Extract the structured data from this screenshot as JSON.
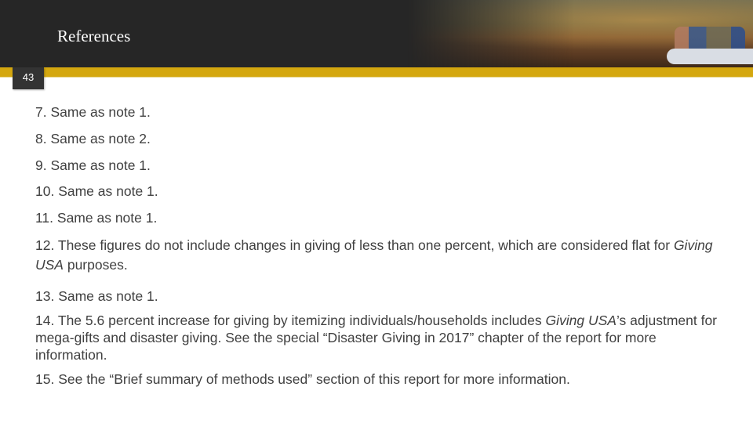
{
  "slide": {
    "title": "References",
    "page_number": "43"
  },
  "notes": [
    {
      "id": "7",
      "text": "7. Same as note 1."
    },
    {
      "id": "8",
      "text": "8. Same as note 2."
    },
    {
      "id": "9",
      "text": "9. Same as note 1."
    },
    {
      "id": "10",
      "text": "10. Same as note 1."
    },
    {
      "id": "11",
      "text": "11. Same as note 1."
    },
    {
      "id": "12",
      "parts": [
        "12. These figures do not include changes in giving of less than one percent, which are considered flat for ",
        "Giving USA",
        " purposes."
      ]
    },
    {
      "id": "13",
      "text": "13. Same as note 1."
    },
    {
      "id": "14",
      "parts": [
        "14. The 5.6 percent increase for giving by itemizing individuals/households includes ",
        "Giving USA",
        "’s adjustment for mega-gifts and disaster giving. See the special “Disaster Giving in 2017” chapter of the report for more information."
      ]
    },
    {
      "id": "15",
      "text": "15. See the “Brief summary of methods used” section of this report for more information."
    }
  ],
  "colors": {
    "header_bg": "#262626",
    "accent_gold": "#d4a70f",
    "body_text": "#404040"
  }
}
